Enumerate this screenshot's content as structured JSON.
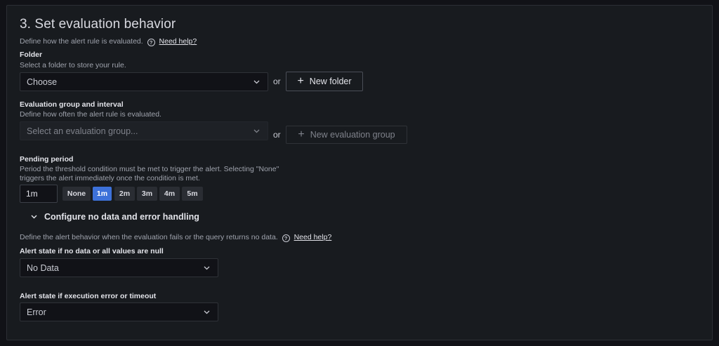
{
  "section": {
    "title": "3. Set evaluation behavior",
    "description": "Define how the alert rule is evaluated.",
    "help_link": "Need help?"
  },
  "folder": {
    "label": "Folder",
    "description": "Select a folder to store your rule.",
    "placeholder": "Choose",
    "or": "or",
    "new_button": "New folder"
  },
  "group": {
    "label": "Evaluation group and interval",
    "description": "Define how often the alert rule is evaluated.",
    "placeholder": "Select an evaluation group...",
    "or": "or",
    "new_button": "New evaluation group"
  },
  "pending": {
    "label": "Pending period",
    "description_line1": "Period the threshold condition must be met to trigger the alert. Selecting \"None\"",
    "description_line2": "triggers the alert immediately once the condition is met.",
    "value": "1m",
    "options": [
      "None",
      "1m",
      "2m",
      "3m",
      "4m",
      "5m"
    ],
    "selected": "1m"
  },
  "nodata": {
    "toggle_label": "Configure no data and error handling",
    "description": "Define the alert behavior when the evaluation fails or the query returns no data.",
    "help_link": "Need help?",
    "no_data_label": "Alert state if no data or all values are null",
    "no_data_value": "No Data",
    "error_label": "Alert state if execution error or timeout",
    "error_value": "Error"
  },
  "colors": {
    "accent": "#3d71d9",
    "background": "#181b1f"
  }
}
